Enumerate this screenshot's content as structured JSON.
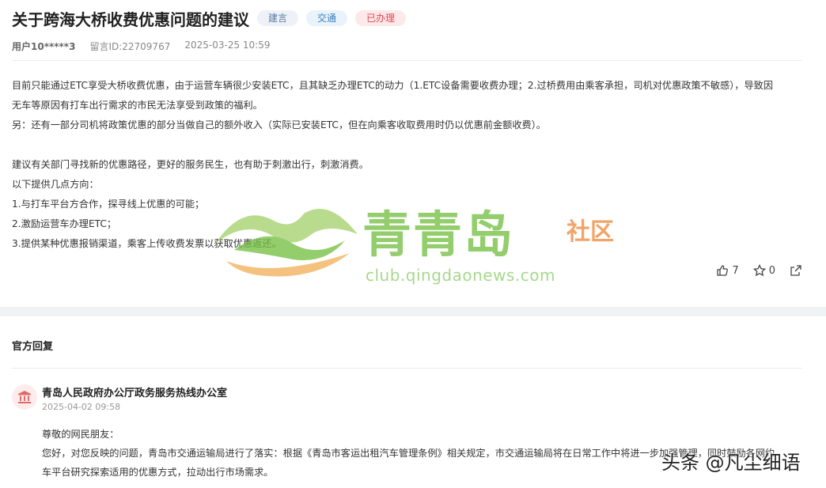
{
  "post": {
    "title": "关于跨海大桥收费优惠问题的建议",
    "tags": [
      "建言",
      "交通",
      "已办理"
    ],
    "user": "用户10*****3",
    "msg_id": "留言ID:22709767",
    "time": "2025-03-25 10:59",
    "body": [
      "目前只能通过ETC享受大桥收费优惠，由于运营车辆很少安装ETC，且其缺乏办理ETC的动力（1.ETC设备需要收费办理；2.过桥费用由乘客承担，司机对优惠政策不敏感），导致因",
      "无车等原因有打车出行需求的市民无法享受到政策的福利。",
      "另：还有一部分司机将政策优惠的部分当做自己的额外收入（实际已安装ETC，但在向乘客收取费用时仍以优惠前金额收费）。",
      "",
      "建议有关部门寻找新的优惠路径，更好的服务民生，也有助于刺激出行，刺激消费。",
      "以下提供几点方向：",
      "1.与打车平台方合作，探寻线上优惠的可能；",
      "2.激励运营车办理ETC；",
      "3.提供某种优惠报销渠道，乘客上传收费发票以获取优惠返还。"
    ],
    "likes": "7",
    "favorites": "0"
  },
  "watermark": {
    "brand": "青青岛",
    "suffix": "社区",
    "url": "club.qingdaonews.com"
  },
  "reply": {
    "section_title": "官方回复",
    "org": "青岛人民政府办公厅政务服务热线办公室",
    "time": "2025-04-02 09:58",
    "lines": [
      "尊敬的网民朋友：",
      "您好，对您反映的问题，青岛市交通运输局进行了落实：根据《青岛市客运出租汽车管理条例》相关规定，市交通运输局将在日常工作中将进一步加强管理，同时鼓励各网约",
      "车平台研究探索适用的优惠方式，拉动出行市场需求。"
    ]
  },
  "overlay": {
    "toutiao": "头条 @凡尘细语"
  },
  "icons": {
    "like": "thumbs-up-icon",
    "favorite": "star-icon",
    "share": "share-icon",
    "avatar": "government-building-icon"
  },
  "colors": {
    "tag_advice": "#56789e",
    "tag_traffic": "#3a7fbf",
    "tag_done": "#e0484f",
    "watermark_green": "#76c043",
    "watermark_orange": "#ef8a3d"
  }
}
